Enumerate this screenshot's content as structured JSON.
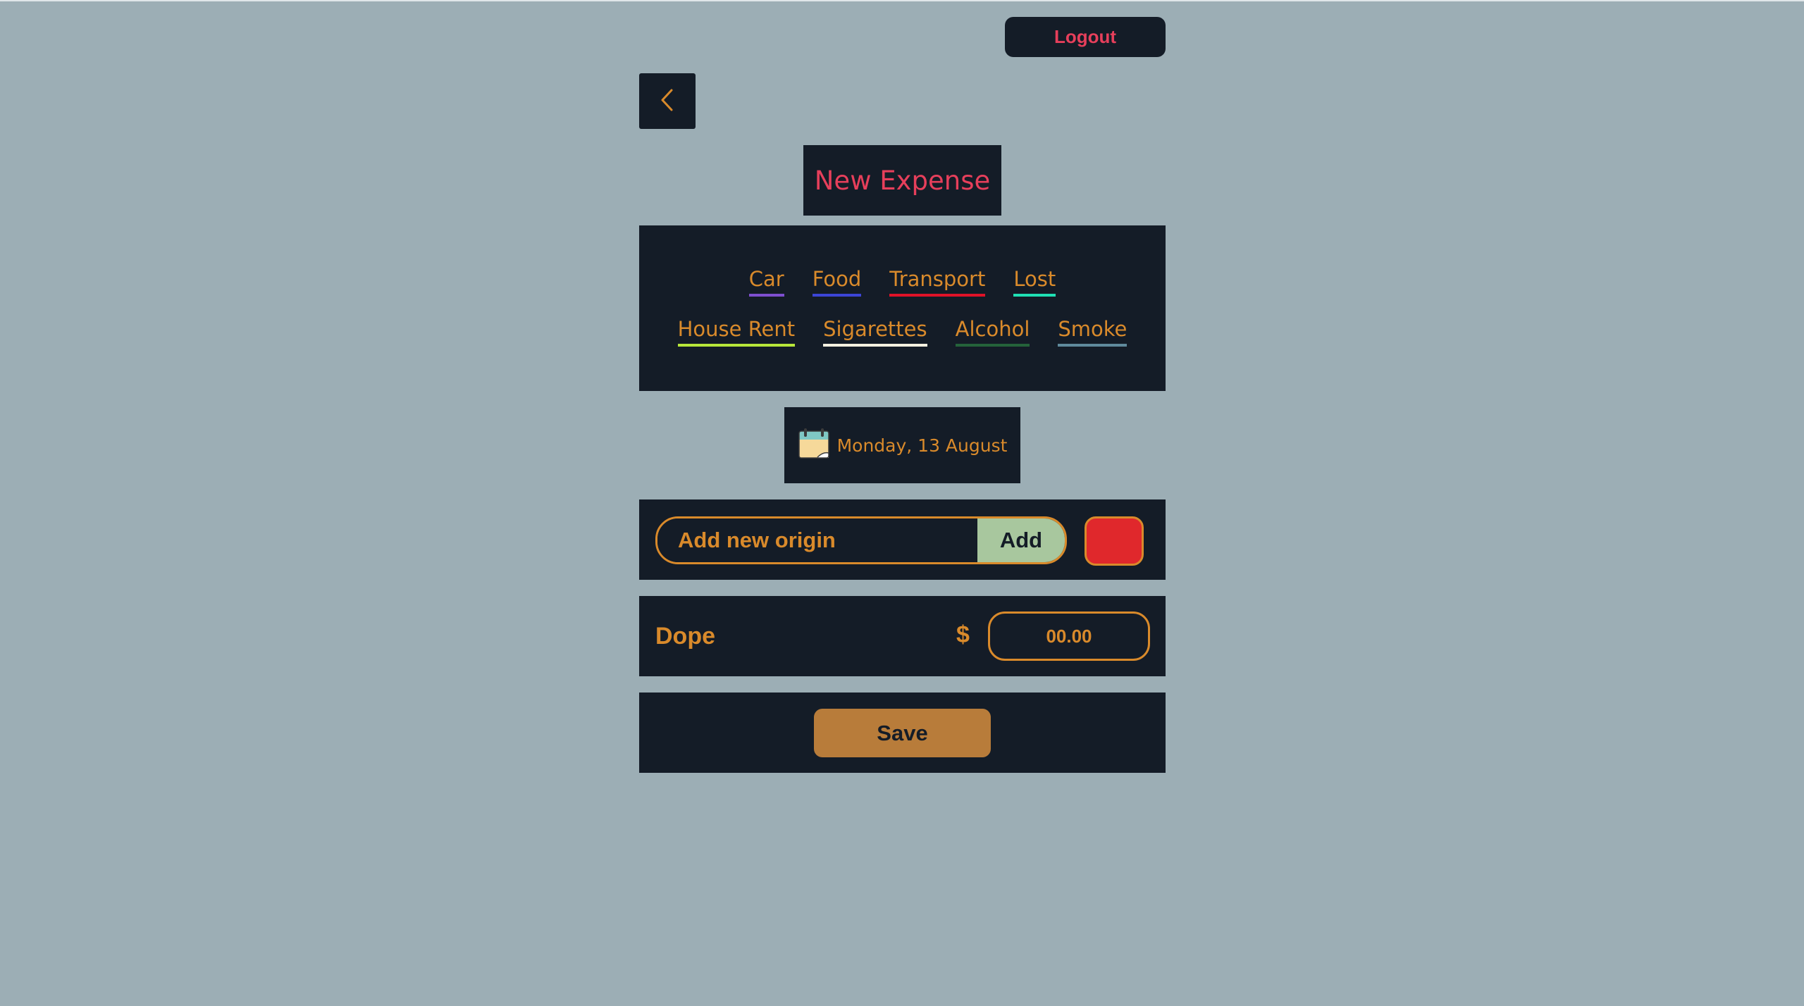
{
  "header": {
    "logout_label": "Logout",
    "back_icon": "chevron-left-icon"
  },
  "page": {
    "title": "New Expense"
  },
  "categories": {
    "row1": [
      {
        "label": "Car",
        "color": "#7e4fd0"
      },
      {
        "label": "Food",
        "color": "#3c45d6"
      },
      {
        "label": "Transport",
        "color": "#e01228"
      },
      {
        "label": "Lost",
        "color": "#1fe0b4"
      }
    ],
    "row2": [
      {
        "label": "House Rent",
        "color": "#b7e63a"
      },
      {
        "label": "Sigarettes",
        "color": "#f4f1e1"
      },
      {
        "label": "Alcohol",
        "color": "#24633a"
      },
      {
        "label": "Smoke",
        "color": "#5f8a9c"
      }
    ]
  },
  "date": {
    "text": "Monday, 13 August",
    "icon": "calendar-icon"
  },
  "origin": {
    "placeholder": "Add new origin",
    "add_label": "Add",
    "swatch_color": "#e0282c"
  },
  "expense": {
    "name": "Dope",
    "currency": "$",
    "amount_placeholder": "00.00"
  },
  "actions": {
    "save_label": "Save"
  },
  "colors": {
    "background": "#9caeb5",
    "panel": "#141c27",
    "accent": "#d98a2b",
    "title": "#e63f5b",
    "save_button": "#b87c3a",
    "add_button": "#a8c79e"
  }
}
